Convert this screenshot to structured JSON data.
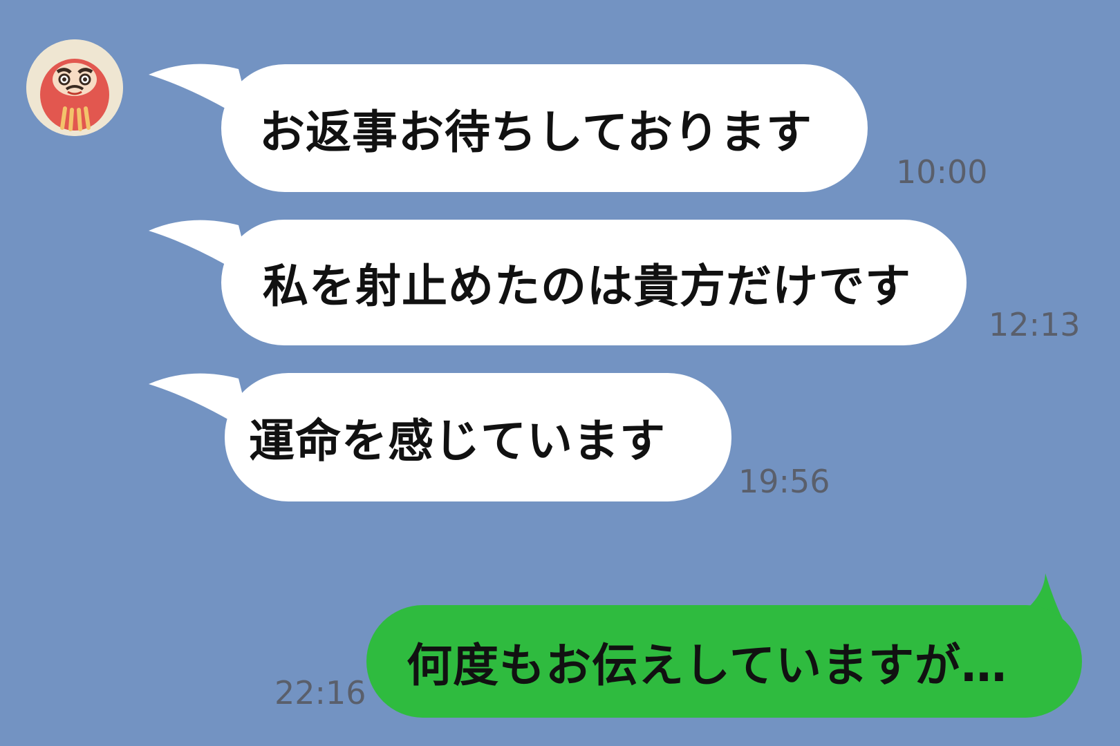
{
  "messages": [
    {
      "direction": "incoming",
      "text": "お返事お待ちしております",
      "time": "10:00"
    },
    {
      "direction": "incoming",
      "text": "私を射止めたのは貴方だけです",
      "time": "12:13"
    },
    {
      "direction": "incoming",
      "text": "運命を感じています",
      "time": "19:56"
    },
    {
      "direction": "outgoing",
      "text": "何度もお伝えしていますが…",
      "time": "22:16"
    }
  ],
  "contact": {
    "avatar_icon": "daruma-icon"
  },
  "colors": {
    "background": "#7393c2",
    "incoming_bubble": "#ffffff",
    "outgoing_bubble": "#2fbb3f",
    "timestamp": "#5a5f6b"
  }
}
